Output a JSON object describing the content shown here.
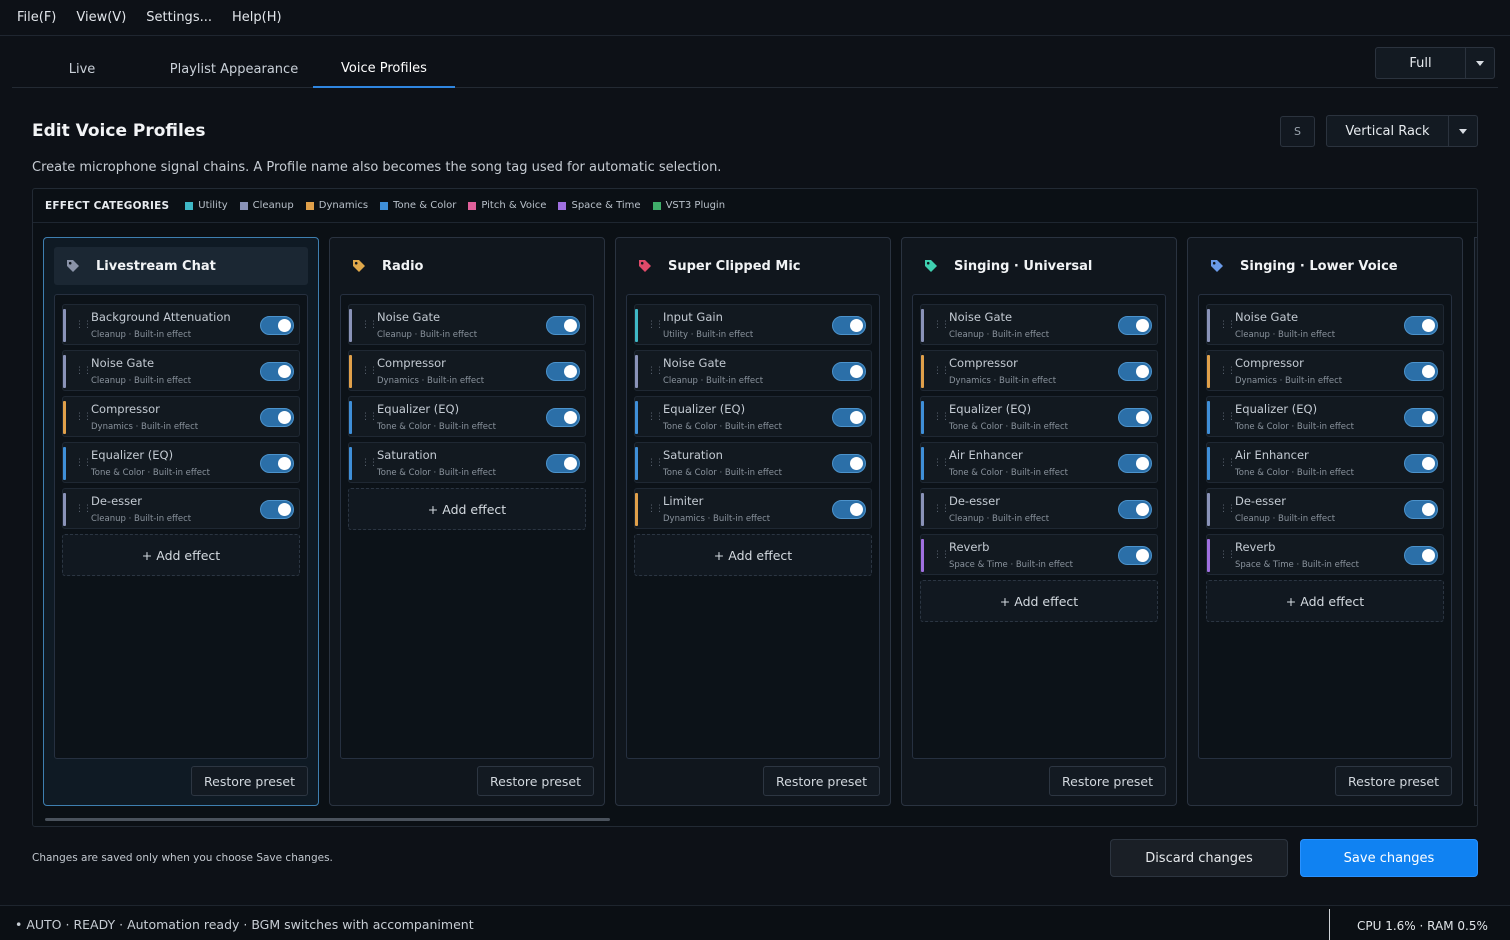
{
  "menu": [
    "File(F)",
    "View(V)",
    "Settings...",
    "Help(H)"
  ],
  "tabs": [
    {
      "label": "Live",
      "active": false
    },
    {
      "label": "Playlist Appearance",
      "active": false
    },
    {
      "label": "Voice Profiles",
      "active": true
    }
  ],
  "view_mode": {
    "value": "Full"
  },
  "page": {
    "title": "Edit Voice Profiles",
    "subtitle": "Create microphone signal chains. A Profile name also becomes the song tag used for automatic selection."
  },
  "size_button": {
    "label": "S"
  },
  "layout_select": {
    "value": "Vertical Rack"
  },
  "legend": {
    "heading": "EFFECT CATEGORIES",
    "items": [
      {
        "label": "Utility",
        "color": "#3fb8c6"
      },
      {
        "label": "Cleanup",
        "color": "#8a93b8"
      },
      {
        "label": "Dynamics",
        "color": "#e0a04a"
      },
      {
        "label": "Tone & Color",
        "color": "#3f8fd8"
      },
      {
        "label": "Pitch & Voice",
        "color": "#e0609a"
      },
      {
        "label": "Space & Time",
        "color": "#a070e0"
      },
      {
        "label": "VST3 Plugin",
        "color": "#3fae6a"
      }
    ]
  },
  "profiles": [
    {
      "name": "Livestream Chat",
      "tag_color": "#8a93a8",
      "selected": true,
      "effects": [
        {
          "name": "Background Attenuation",
          "meta": "Cleanup · Built-in effect",
          "color": "#8a93b8",
          "enabled": true
        },
        {
          "name": "Noise Gate",
          "meta": "Cleanup · Built-in effect",
          "color": "#8a93b8",
          "enabled": true
        },
        {
          "name": "Compressor",
          "meta": "Dynamics · Built-in effect",
          "color": "#e0a04a",
          "enabled": true
        },
        {
          "name": "Equalizer (EQ)",
          "meta": "Tone & Color · Built-in effect",
          "color": "#3f8fd8",
          "enabled": true
        },
        {
          "name": "De-esser",
          "meta": "Cleanup · Built-in effect",
          "color": "#8a93b8",
          "enabled": true
        }
      ]
    },
    {
      "name": "Radio",
      "tag_color": "#e0a84a",
      "selected": false,
      "effects": [
        {
          "name": "Noise Gate",
          "meta": "Cleanup · Built-in effect",
          "color": "#8a93b8",
          "enabled": true
        },
        {
          "name": "Compressor",
          "meta": "Dynamics · Built-in effect",
          "color": "#e0a04a",
          "enabled": true
        },
        {
          "name": "Equalizer (EQ)",
          "meta": "Tone & Color · Built-in effect",
          "color": "#3f8fd8",
          "enabled": true
        },
        {
          "name": "Saturation",
          "meta": "Tone & Color · Built-in effect",
          "color": "#3f8fd8",
          "enabled": true
        }
      ]
    },
    {
      "name": "Super Clipped Mic",
      "tag_color": "#e04a6a",
      "selected": false,
      "effects": [
        {
          "name": "Input Gain",
          "meta": "Utility · Built-in effect",
          "color": "#3fb8c6",
          "enabled": true
        },
        {
          "name": "Noise Gate",
          "meta": "Cleanup · Built-in effect",
          "color": "#8a93b8",
          "enabled": true
        },
        {
          "name": "Equalizer (EQ)",
          "meta": "Tone & Color · Built-in effect",
          "color": "#3f8fd8",
          "enabled": true
        },
        {
          "name": "Saturation",
          "meta": "Tone & Color · Built-in effect",
          "color": "#3f8fd8",
          "enabled": true
        },
        {
          "name": "Limiter",
          "meta": "Dynamics · Built-in effect",
          "color": "#e0a04a",
          "enabled": true
        }
      ]
    },
    {
      "name": "Singing · Universal",
      "tag_color": "#3fd0b0",
      "selected": false,
      "effects": [
        {
          "name": "Noise Gate",
          "meta": "Cleanup · Built-in effect",
          "color": "#8a93b8",
          "enabled": true
        },
        {
          "name": "Compressor",
          "meta": "Dynamics · Built-in effect",
          "color": "#e0a04a",
          "enabled": true
        },
        {
          "name": "Equalizer (EQ)",
          "meta": "Tone & Color · Built-in effect",
          "color": "#3f8fd8",
          "enabled": true
        },
        {
          "name": "Air Enhancer",
          "meta": "Tone & Color · Built-in effect",
          "color": "#3f8fd8",
          "enabled": true
        },
        {
          "name": "De-esser",
          "meta": "Cleanup · Built-in effect",
          "color": "#8a93b8",
          "enabled": true
        },
        {
          "name": "Reverb",
          "meta": "Space & Time · Built-in effect",
          "color": "#a070e0",
          "enabled": true
        }
      ]
    },
    {
      "name": "Singing · Lower Voice",
      "tag_color": "#6a9ae8",
      "selected": false,
      "effects": [
        {
          "name": "Noise Gate",
          "meta": "Cleanup · Built-in effect",
          "color": "#8a93b8",
          "enabled": true
        },
        {
          "name": "Compressor",
          "meta": "Dynamics · Built-in effect",
          "color": "#e0a04a",
          "enabled": true
        },
        {
          "name": "Equalizer (EQ)",
          "meta": "Tone & Color · Built-in effect",
          "color": "#3f8fd8",
          "enabled": true
        },
        {
          "name": "Air Enhancer",
          "meta": "Tone & Color · Built-in effect",
          "color": "#3f8fd8",
          "enabled": true
        },
        {
          "name": "De-esser",
          "meta": "Cleanup · Built-in effect",
          "color": "#8a93b8",
          "enabled": true
        },
        {
          "name": "Reverb",
          "meta": "Space & Time · Built-in effect",
          "color": "#a070e0",
          "enabled": true
        }
      ]
    }
  ],
  "labels": {
    "add_effect": "+ Add effect",
    "restore_preset": "Restore preset"
  },
  "footer": {
    "note": "Changes are saved only when you choose Save changes.",
    "discard": "Discard changes",
    "save": "Save changes"
  },
  "status": {
    "left": "•  AUTO · READY · Automation ready · BGM switches with accompaniment",
    "right": "CPU 1.6% · RAM 0.5%"
  }
}
